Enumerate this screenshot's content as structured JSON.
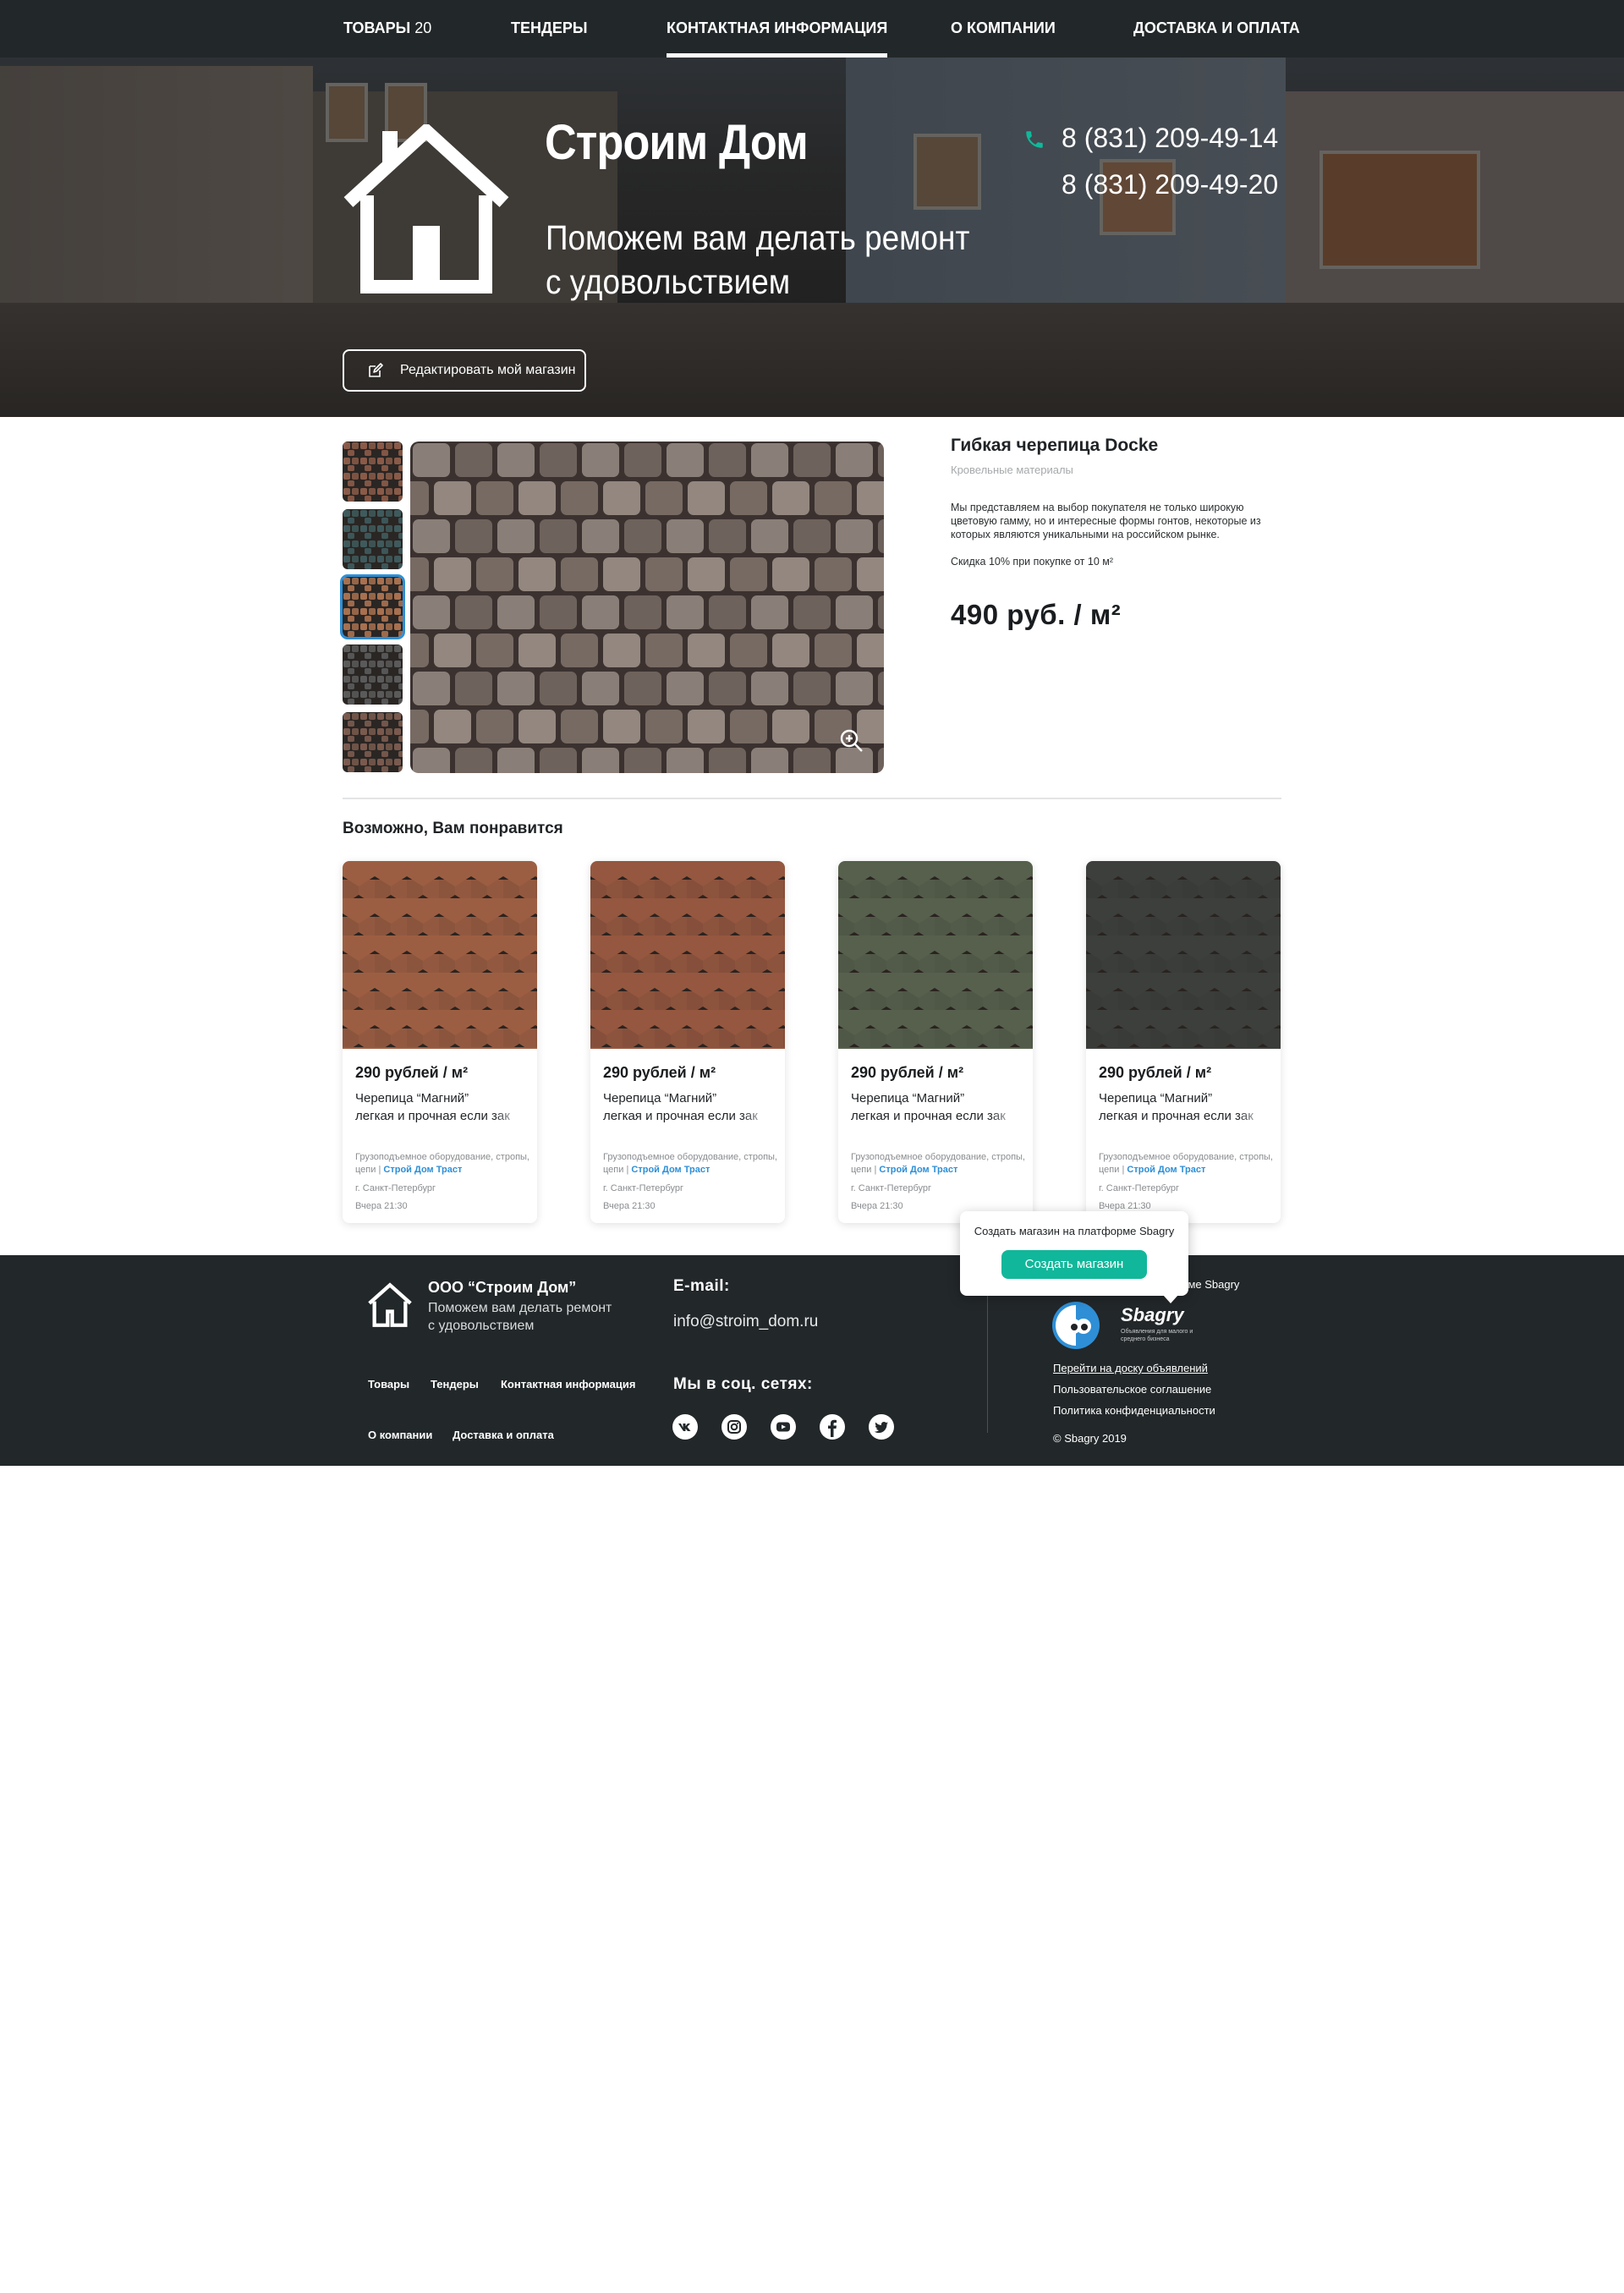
{
  "nav": {
    "items": [
      {
        "label": "Товары",
        "count": "20"
      },
      {
        "label": "Тендеры"
      },
      {
        "label": "Контактная информация"
      },
      {
        "label": "О компании"
      },
      {
        "label": "Доставка и оплата"
      }
    ],
    "active": "Контактная информация"
  },
  "hero": {
    "title": "Строим Дом",
    "subtitle": "Поможем вам делать ремонт с удовольствием",
    "phones": [
      "8 (831) 209-49-14",
      "8 (831) 209-49-20"
    ],
    "edit_button": "Редактировать мой магазин",
    "icons": {
      "logo": "house-icon",
      "phone": "phone-icon",
      "edit": "pen-icon"
    }
  },
  "product": {
    "title": "Гибкая черепица Docke",
    "category": "Кровельные материалы",
    "description": "Мы представляем на выбор покупателя не только широкую цветовую гамму, но и интересные формы гонтов, некоторые из которых являются уникальными на российском рынке.",
    "discount": "Скидка 10% при покупке от 10 м²",
    "price": "490 руб. / м²",
    "thumbnail_colors": [
      "#8a5a48",
      "#3f5a5c",
      "#a8704f",
      "#5a5a5a",
      "#7a5a4e"
    ],
    "selected_thumbnail": 3
  },
  "recommendations": {
    "title": "Возможно, Вам понравится",
    "cards": [
      {
        "price": "290 рублей / м²",
        "name_line1": "Черепица “Магний”",
        "name_line2": "легкая и прочная если зак",
        "categories": "Грузоподъемное оборудование, стропы, цепи",
        "seller": "Строй Дом Траст",
        "city": "г. Санкт-Петербург",
        "time": "Вчера 21:30",
        "color": "#9c5e42"
      },
      {
        "price": "290 рублей / м²",
        "name_line1": "Черепица “Магний”",
        "name_line2": "легкая и прочная если зак",
        "categories": "Грузоподъемное оборудование, стропы, цепи",
        "seller": "Строй Дом Траст",
        "city": "г. Санкт-Петербург",
        "time": "Вчера 21:30",
        "color": "#95573f"
      },
      {
        "price": "290 рублей / м²",
        "name_line1": "Черепица “Магний”",
        "name_line2": "легкая и прочная если зак",
        "categories": "Грузоподъемное оборудование, стропы, цепи",
        "seller": "Строй Дом Траст",
        "city": "г. Санкт-Петербург",
        "time": "Вчера 21:30",
        "color": "#56604c"
      },
      {
        "price": "290 рублей / м²",
        "name_line1": "Черепица “Магний”",
        "name_line2": "легкая и прочная если зак",
        "categories": "Грузоподъемное оборудование, стропы, цепи",
        "seller": "Строй Дом Траст",
        "city": "г. Санкт-Петербург",
        "time": "Вчера 21:30",
        "color": "#3c3f3c"
      }
    ]
  },
  "footer": {
    "company": "ООО “Строим Дом”",
    "slogan": "Поможем вам делать ремонт с удовольствием",
    "links": [
      "Товары",
      "Тендеры",
      "Контактная информация",
      "О компании",
      "Доставка и оплата"
    ],
    "email_label": "E-mail:",
    "email": "info@stroim_dom.ru",
    "social_label": "Мы в соц. сетях:",
    "social_icons": [
      "vk-icon",
      "instagram-icon",
      "youtube-icon",
      "facebook-icon",
      "twitter-icon"
    ],
    "sbagry_text": "орме Sbagry",
    "sbagry_name": "Sbagry",
    "sbagry_tagline": "Объявления для малого и среднего бизнеса",
    "board_link": "Перейти на доску объявлений",
    "agreement_link": "Пользовательское соглашение",
    "privacy_link": "Политика конфиденциальности",
    "copyright": "© Sbagry 2019"
  },
  "popup": {
    "text": "Создать магазин на платформе Sbagry",
    "button": "Создать магазин"
  },
  "colors": {
    "dark": "#222729",
    "accent": "#11b79a",
    "link": "#2e8fd6"
  }
}
